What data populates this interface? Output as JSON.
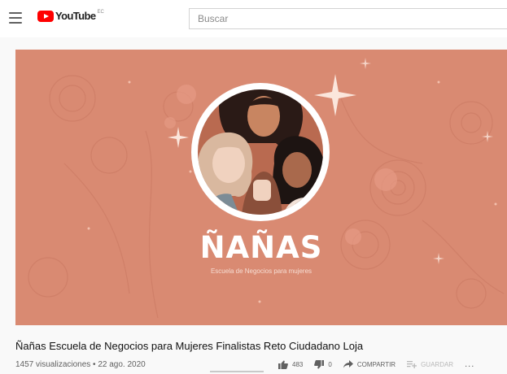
{
  "header": {
    "logo_text": "YouTube",
    "country_code": "EC",
    "search_placeholder": "Buscar"
  },
  "video": {
    "brand_name": "ÑAÑAS",
    "brand_tagline": "Escuela de Negocios para mujeres",
    "background_color": "#d98a72"
  },
  "info": {
    "title": "Ñañas Escuela de Negocios para Mujeres Finalistas Reto Ciudadano Loja",
    "views_date": "1457 visualizaciones • 22 ago. 2020",
    "likes": "483",
    "dislikes": "0",
    "share_label": "COMPARTIR",
    "save_label": "GUARDAR",
    "more_label": "..."
  },
  "icons": {
    "menu": "hamburger-menu-icon",
    "like": "thumbs-up-icon",
    "dislike": "thumbs-down-icon",
    "share": "share-arrow-icon",
    "save": "playlist-add-icon"
  },
  "colors": {
    "brand_red": "#ff0000",
    "text_secondary": "#606060"
  }
}
